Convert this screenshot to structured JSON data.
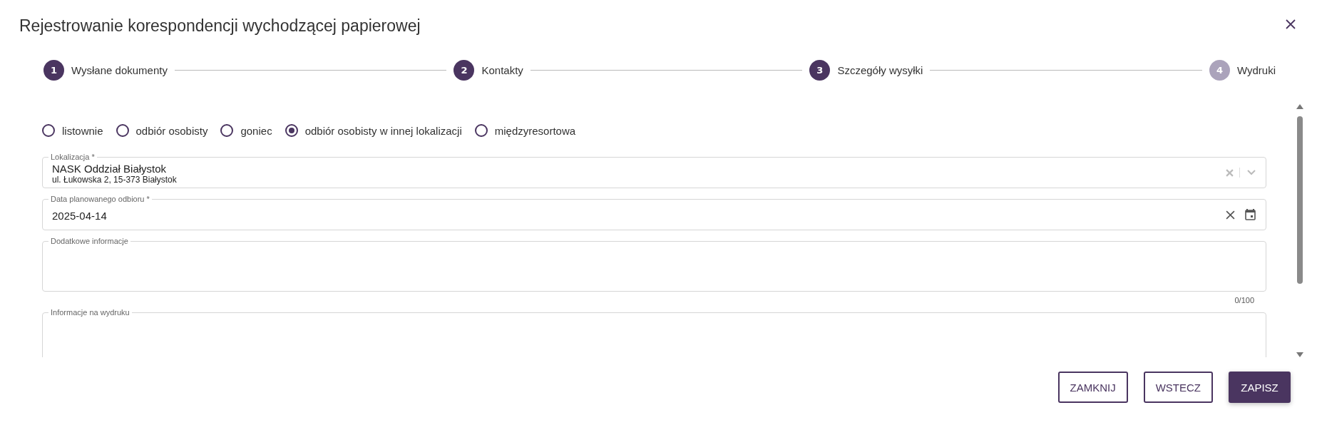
{
  "dialog": {
    "title": "Rejestrowanie korespondencji wychodzącej papierowej"
  },
  "steps": [
    {
      "number": "1",
      "label": "Wysłane dokumenty",
      "reached": true
    },
    {
      "number": "2",
      "label": "Kontakty",
      "reached": true
    },
    {
      "number": "3",
      "label": "Szczegóły wysyłki",
      "reached": true
    },
    {
      "number": "4",
      "label": "Wydruki",
      "reached": false
    }
  ],
  "delivery_options": [
    {
      "label": "listownie",
      "selected": false
    },
    {
      "label": "odbiór osobisty",
      "selected": false
    },
    {
      "label": "goniec",
      "selected": false
    },
    {
      "label": "odbiór osobisty w innej lokalizacji",
      "selected": true
    },
    {
      "label": "międzyresortowa",
      "selected": false
    }
  ],
  "fields": [
    {
      "kind": "select",
      "label": "Lokalizacja *",
      "value": "NASK Oddział Białystok",
      "subvalue": "ul. Łukowska 2, 15-373 Białystok"
    },
    {
      "kind": "date",
      "label": "Data planowanego odbioru *",
      "value": "2025-04-14"
    },
    {
      "kind": "textarea",
      "label": "Dodatkowe informacje",
      "counter": "0/100"
    },
    {
      "kind": "textarea",
      "label": "Informacje na wydruku"
    }
  ],
  "buttons": [
    {
      "label": "ZAMKNIJ",
      "primary": false
    },
    {
      "label": "WSTECZ",
      "primary": false
    },
    {
      "label": "ZAPISZ",
      "primary": true
    }
  ]
}
